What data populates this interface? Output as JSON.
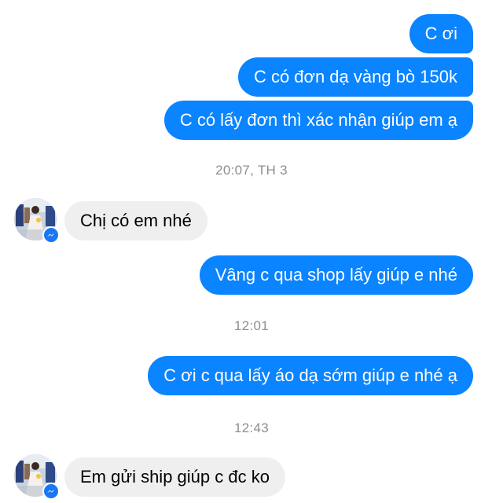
{
  "conversation": {
    "messages": [
      {
        "text": "C ơi",
        "direction": "outgoing"
      },
      {
        "text": "C có đơn dạ vàng bò 150k",
        "direction": "outgoing"
      },
      {
        "text": "C có lấy đơn thì xác nhận giúp em ạ",
        "direction": "outgoing"
      },
      {
        "text": "Chị có em nhé",
        "direction": "incoming"
      },
      {
        "text": "Vâng c qua shop lấy giúp e nhé",
        "direction": "outgoing"
      },
      {
        "text": "C ơi c qua lấy áo dạ sớm giúp e nhé ạ",
        "direction": "outgoing"
      },
      {
        "text": "Em gửi ship giúp c đc ko",
        "direction": "incoming"
      }
    ],
    "timestamps": [
      "20:07, TH 3",
      "12:01",
      "12:43"
    ]
  },
  "colors": {
    "outgoing_bubble": "#0a84ff",
    "incoming_bubble": "#efeff0",
    "timestamp_text": "#8e8e93",
    "badge": "#1877f2"
  },
  "icons": {
    "contact_avatar": "avatar-photo",
    "badge": "messenger-icon"
  }
}
